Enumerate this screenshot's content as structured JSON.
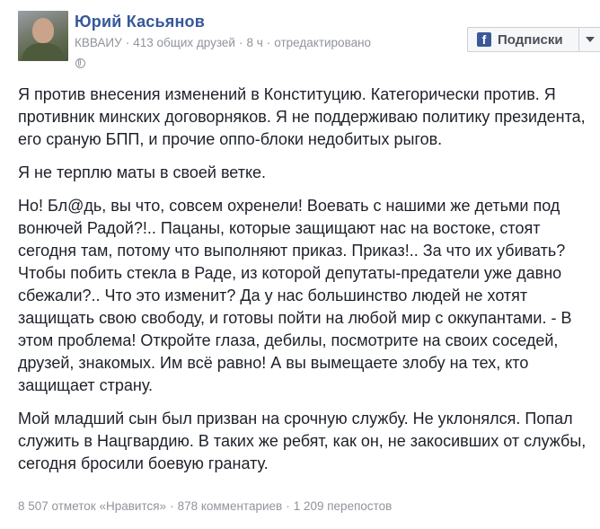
{
  "author": {
    "name": "Юрий Касьянов",
    "school": "КВВАИУ",
    "mutual_friends": "413 общих друзей",
    "time": "8 ч",
    "edited": "отредактировано"
  },
  "follow_button": {
    "label": "Подписки",
    "icon_letter": "f"
  },
  "post": {
    "paragraphs": [
      "Я против внесения изменений в Конституцию. Категорически против. Я противник минских договорняков. Я не поддерживаю политику президента, его сраную БПП, и прочие оппо-блоки недобитых рыгов.",
      "Я не терплю маты в своей ветке.",
      "Но! Бл@дь, вы что, совсем охренели! Воевать с нашими же детьми под вонючей Радой?!.. Пацаны, которые защищают нас на востоке, стоят сегодня там, потому что выполняют приказ. Приказ!.. За что их убивать? Чтобы побить стекла в Раде, из которой депутаты-предатели уже давно сбежали?.. Что это изменит? Да у нас большинство людей не хотят защищать свою свободу, и готовы пойти на любой мир с оккупантами. - В этом проблема! Откройте глаза, дебилы, посмотрите на своих соседей, друзей, знакомых. Им всё равно! А вы вымещаете злобу на тех, кто защищает страну.",
      "Мой младший сын был призван на срочную службу. Не уклонялся. Попал служить в Нацгвардию. В таких же ребят, как он, не закосивших от службы, сегодня бросили боевую гранату."
    ]
  },
  "stats": {
    "likes": "8 507 отметок «Нравится»",
    "comments": "878 комментариев",
    "shares": "1 209 перепостов"
  },
  "separator": "·",
  "colors": {
    "name": "#365899",
    "meta": "#90949c",
    "text": "#1d2129",
    "fb_blue": "#3b5998"
  }
}
